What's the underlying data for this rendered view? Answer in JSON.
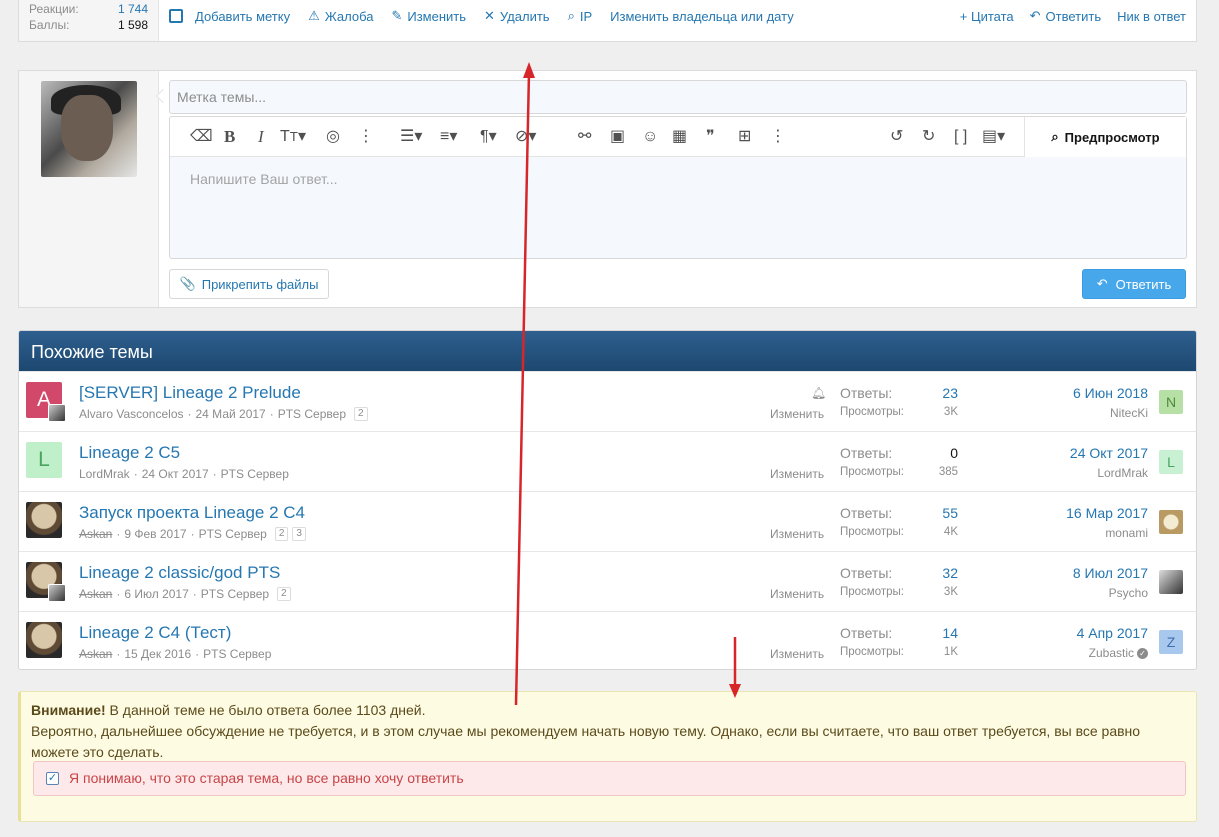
{
  "post_footer": {
    "stats": [
      {
        "label": "Реакции:",
        "value": "1 744"
      },
      {
        "label": "Баллы:",
        "value": "1 598"
      }
    ],
    "actions": {
      "add_label": "Добавить метку",
      "report": "Жалоба",
      "edit": "Изменить",
      "delete": "Удалить",
      "ip": "IP",
      "change_owner": "Изменить владельца или дату"
    },
    "right_actions": {
      "quote": "+ Цитата",
      "reply": "Ответить",
      "nick": "Ник в ответ"
    }
  },
  "reply_form": {
    "title_placeholder": "Метка темы...",
    "body_placeholder": "Напишите Ваш ответ...",
    "preview_label": "Предпросмотр",
    "attach_label": "Прикрепить файлы",
    "submit_label": "Ответить"
  },
  "similar": {
    "heading": "Похожие темы",
    "labels": {
      "replies": "Ответы:",
      "views": "Просмотры:",
      "edit": "Изменить"
    },
    "threads": [
      {
        "title": "[SERVER] Lineage 2 Prelude",
        "author": "Alvaro Vasconcelos",
        "date": "24 Май 2017",
        "forum": "PTS Сервер",
        "pages": [
          "2"
        ],
        "replies": "23",
        "views": "3K",
        "last_date": "6 Июн 2018",
        "last_user": "NitecKi",
        "avatar_letter": "A",
        "last_avatar_letter": "N"
      },
      {
        "title": "Lineage 2 C5",
        "author": "LordMrak",
        "date": "24 Окт 2017",
        "forum": "PTS Сервер",
        "pages": [],
        "replies": "0",
        "views": "385",
        "last_date": "24 Окт 2017",
        "last_user": "LordMrak",
        "avatar_letter": "L",
        "last_avatar_letter": "L"
      },
      {
        "title": "Запуск проекта Lineage 2 C4",
        "author": "Askan",
        "date": "9 Фев 2017",
        "forum": "PTS Сервер",
        "pages": [
          "2",
          "3"
        ],
        "replies": "55",
        "views": "4K",
        "last_date": "16 Мар 2017",
        "last_user": "monami",
        "avatar_letter": "",
        "last_avatar_letter": ""
      },
      {
        "title": "Lineage 2 classic/god PTS",
        "author": "Askan",
        "date": "6 Июл 2017",
        "forum": "PTS Сервер",
        "pages": [
          "2"
        ],
        "replies": "32",
        "views": "3K",
        "last_date": "8 Июл 2017",
        "last_user": "Psycho",
        "avatar_letter": "",
        "last_avatar_letter": ""
      },
      {
        "title": "Lineage 2 C4 (Тест)",
        "author": "Askan",
        "date": "15 Дек 2016",
        "forum": "PTS Сервер",
        "pages": [],
        "replies": "14",
        "views": "1K",
        "last_date": "4 Апр 2017",
        "last_user": "Zubastic",
        "avatar_letter": "",
        "last_avatar_letter": "Z"
      }
    ]
  },
  "warning": {
    "title": "Внимание!",
    "line1": " В данной теме не было ответа более 1103 дней.",
    "line2": "Вероятно, дальнейшее обсуждение не требуется, и в этом случае мы рекомендуем начать новую тему. Однако, если вы считаете, что ваш ответ требуется, вы все равно можете это сделать.",
    "confirm": "Я понимаю, что это старая тема, но все равно хочу ответить"
  },
  "colors": {
    "accent": "#2577b1",
    "header": "#1d4870",
    "reply_button": "#47a7eb",
    "annotation_arrow": "#d7262a"
  }
}
